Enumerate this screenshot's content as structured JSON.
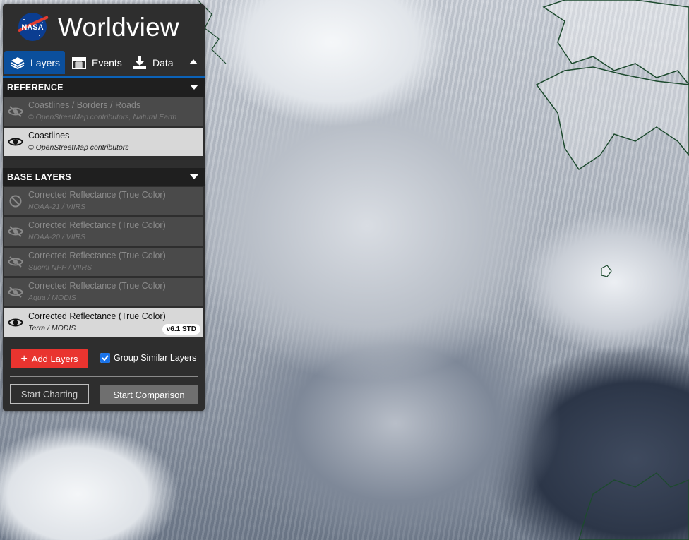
{
  "app": {
    "title": "Worldview",
    "logo_text": "NASA"
  },
  "tabs": [
    {
      "label": "Layers",
      "icon": "layers-icon",
      "active": true
    },
    {
      "label": "Events",
      "icon": "calendar-icon",
      "active": false
    },
    {
      "label": "Data",
      "icon": "download-icon",
      "active": false
    }
  ],
  "groups": {
    "reference": {
      "title": "REFERENCE",
      "layers": [
        {
          "name": "Coastlines / Borders / Roads",
          "source": "© OpenStreetMap contributors, Natural Earth",
          "visible": false
        },
        {
          "name": "Coastlines",
          "source": "© OpenStreetMap contributors",
          "visible": true
        }
      ]
    },
    "base": {
      "title": "BASE LAYERS",
      "layers": [
        {
          "name": "Corrected Reflectance (True Color)",
          "source": "NOAA-21 / VIIRS",
          "visible": false,
          "status": "unavailable"
        },
        {
          "name": "Corrected Reflectance (True Color)",
          "source": "NOAA-20 / VIIRS",
          "visible": false
        },
        {
          "name": "Corrected Reflectance (True Color)",
          "source": "Suomi NPP / VIIRS",
          "visible": false
        },
        {
          "name": "Corrected Reflectance (True Color)",
          "source": "Aqua / MODIS",
          "visible": false
        },
        {
          "name": "Corrected Reflectance (True Color)",
          "source": "Terra / MODIS",
          "visible": true,
          "badge": "v6.1 STD"
        }
      ]
    }
  },
  "actions": {
    "add_layers": "Add Layers",
    "group_similar": "Group Similar Layers",
    "group_similar_checked": true,
    "start_charting": "Start Charting",
    "start_comparison": "Start Comparison"
  },
  "colors": {
    "panel": "#2e2e2e",
    "accent_blue": "#0b4f9c",
    "add_button": "#e9342f",
    "visible_row": "#d8d8d8",
    "hidden_row": "#4a4a4a"
  }
}
